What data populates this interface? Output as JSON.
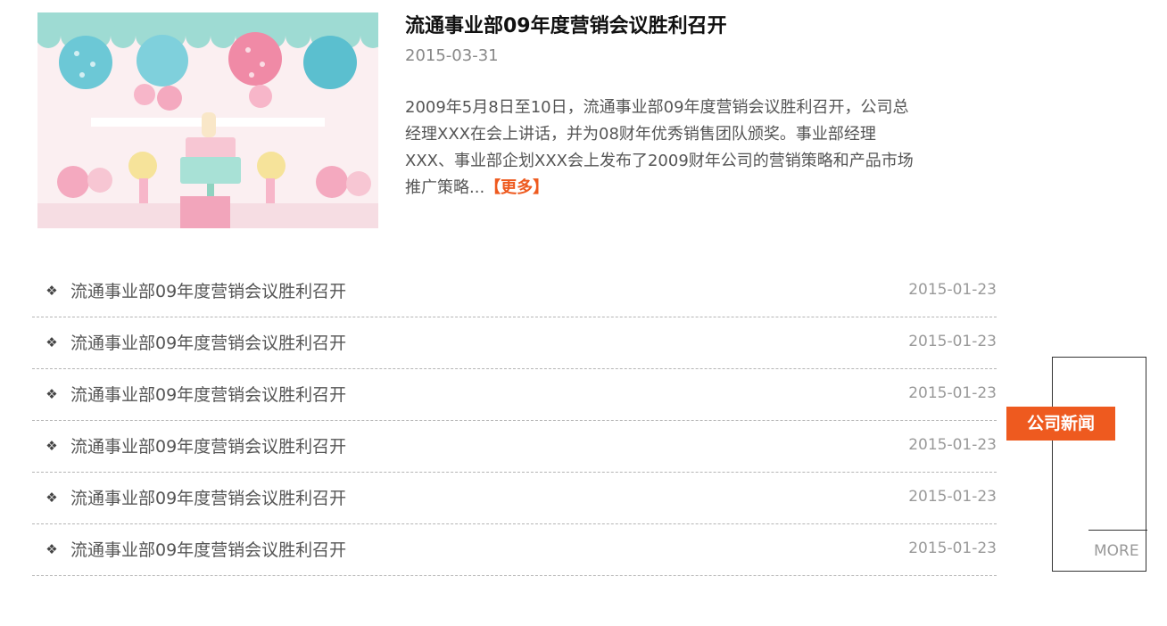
{
  "feature": {
    "image_icon": "party-cake-photo",
    "title": "流通事业部09年度营销会议胜利召开",
    "date": "2015-03-31",
    "description": "2009年5月8日至10日，流通事业部09年度营销会议胜利召开，公司总经理XXX在会上讲话，并为08财年优秀销售团队颁奖。事业部经理XXX、事业部企划XXX会上发布了2009财年公司的营销策略和产品市场推广策略...",
    "more_label": "【更多】"
  },
  "news": [
    {
      "title": "流通事业部09年度营销会议胜利召开",
      "date": "2015-01-23"
    },
    {
      "title": "流通事业部09年度营销会议胜利召开",
      "date": "2015-01-23"
    },
    {
      "title": "流通事业部09年度营销会议胜利召开",
      "date": "2015-01-23"
    },
    {
      "title": "流通事业部09年度营销会议胜利召开",
      "date": "2015-01-23"
    },
    {
      "title": "流通事业部09年度营销会议胜利召开",
      "date": "2015-01-23"
    },
    {
      "title": "流通事业部09年度营销会议胜利召开",
      "date": "2015-01-23"
    }
  ],
  "bullet_icon": "diamond-bullet-icon",
  "bullet_glyph": "❖",
  "side": {
    "label": "公司新闻",
    "more": "MORE"
  },
  "colors": {
    "accent": "#ee5a1f",
    "divider": "#b5b5b5"
  }
}
